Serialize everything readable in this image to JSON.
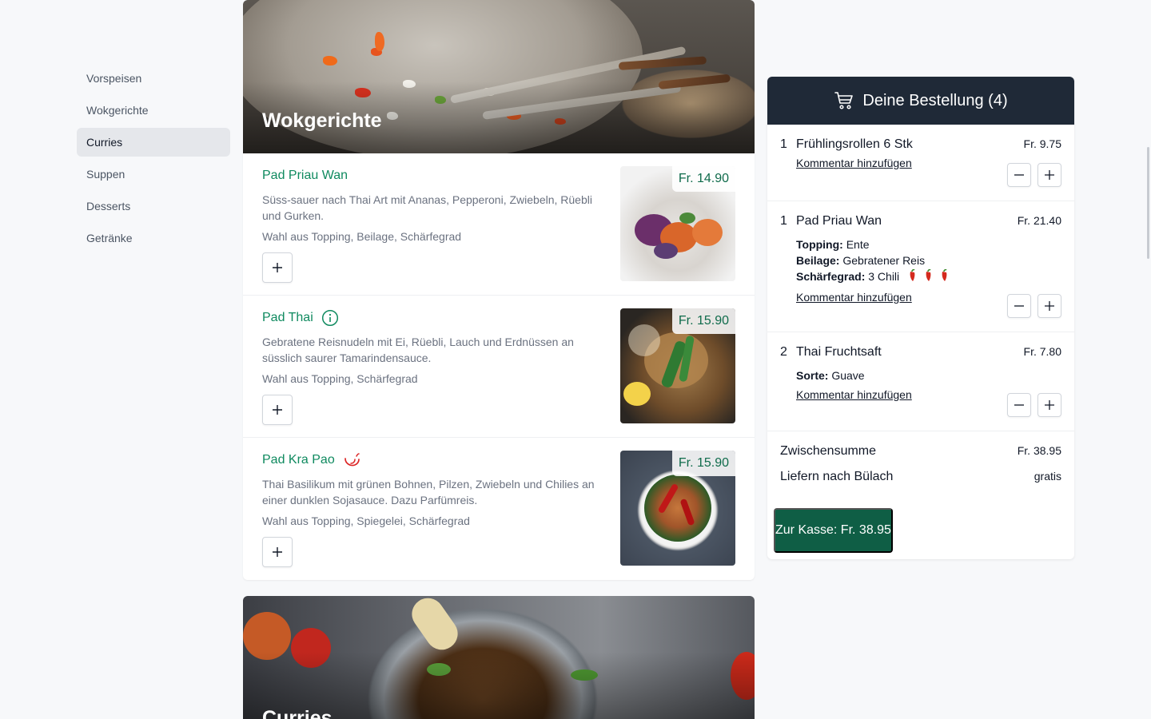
{
  "sidebar": {
    "items": [
      {
        "label": "Vorspeisen"
      },
      {
        "label": "Wokgerichte"
      },
      {
        "label": "Curries",
        "active": true
      },
      {
        "label": "Suppen"
      },
      {
        "label": "Desserts"
      },
      {
        "label": "Getränke"
      }
    ]
  },
  "menu": {
    "sections": [
      {
        "title": "Wokgerichte",
        "dishes": [
          {
            "name": "Pad Priau Wan",
            "badge": "",
            "description": "Süss-sauer nach Thai Art mit Ananas, Pepperoni, Zwiebeln, Rüebli und Gurken.",
            "options": "Wahl aus Topping, Beilage, Schärfegrad",
            "price": "Fr. 14.90"
          },
          {
            "name": "Pad Thai",
            "badge": "info-icon",
            "description": "Gebratene Reisnudeln mit Ei, Rüebli, Lauch und Erdnüssen an süsslich saurer Tamarindensauce.",
            "options": "Wahl aus Topping, Schärfegrad",
            "price": "Fr. 15.90"
          },
          {
            "name": "Pad Kra Pao",
            "badge": "chili-icon",
            "description": "Thai Basilikum mit grünen Bohnen, Pilzen, Zwiebeln und Chilies an einer dunklen Sojasauce. Dazu Parfümreis.",
            "options": "Wahl aus Topping, Spiegelei, Schärfegrad",
            "price": "Fr. 15.90"
          }
        ]
      },
      {
        "title": "Curries"
      }
    ]
  },
  "cart": {
    "title": "Deine Bestellung (4)",
    "comment_label": "Kommentar hinzufügen",
    "items": [
      {
        "qty": "1",
        "name": "Frühlingsrollen 6 Stk",
        "price": "Fr. 9.75",
        "options": []
      },
      {
        "qty": "1",
        "name": "Pad Priau Wan",
        "price": "Fr. 21.40",
        "options": [
          {
            "key": "Topping:",
            "value": "Ente"
          },
          {
            "key": "Beilage:",
            "value": "Gebratener Reis"
          },
          {
            "key": "Schärfegrad:",
            "value": "3 Chili",
            "chilis": 3
          }
        ]
      },
      {
        "qty": "2",
        "name": "Thai Fruchtsaft",
        "price": "Fr. 7.80",
        "options": [
          {
            "key": "Sorte:",
            "value": "Guave"
          }
        ]
      }
    ],
    "subtotal_label": "Zwischensumme",
    "subtotal_value": "Fr. 38.95",
    "delivery_label": "Liefern nach Bülach",
    "delivery_value": "gratis",
    "checkout_label": "Zur Kasse: Fr. 38.95"
  },
  "colors": {
    "accent": "#0f8a5f",
    "checkout": "#0f5e45",
    "header": "#1f2937",
    "chili": "#dc2626"
  }
}
